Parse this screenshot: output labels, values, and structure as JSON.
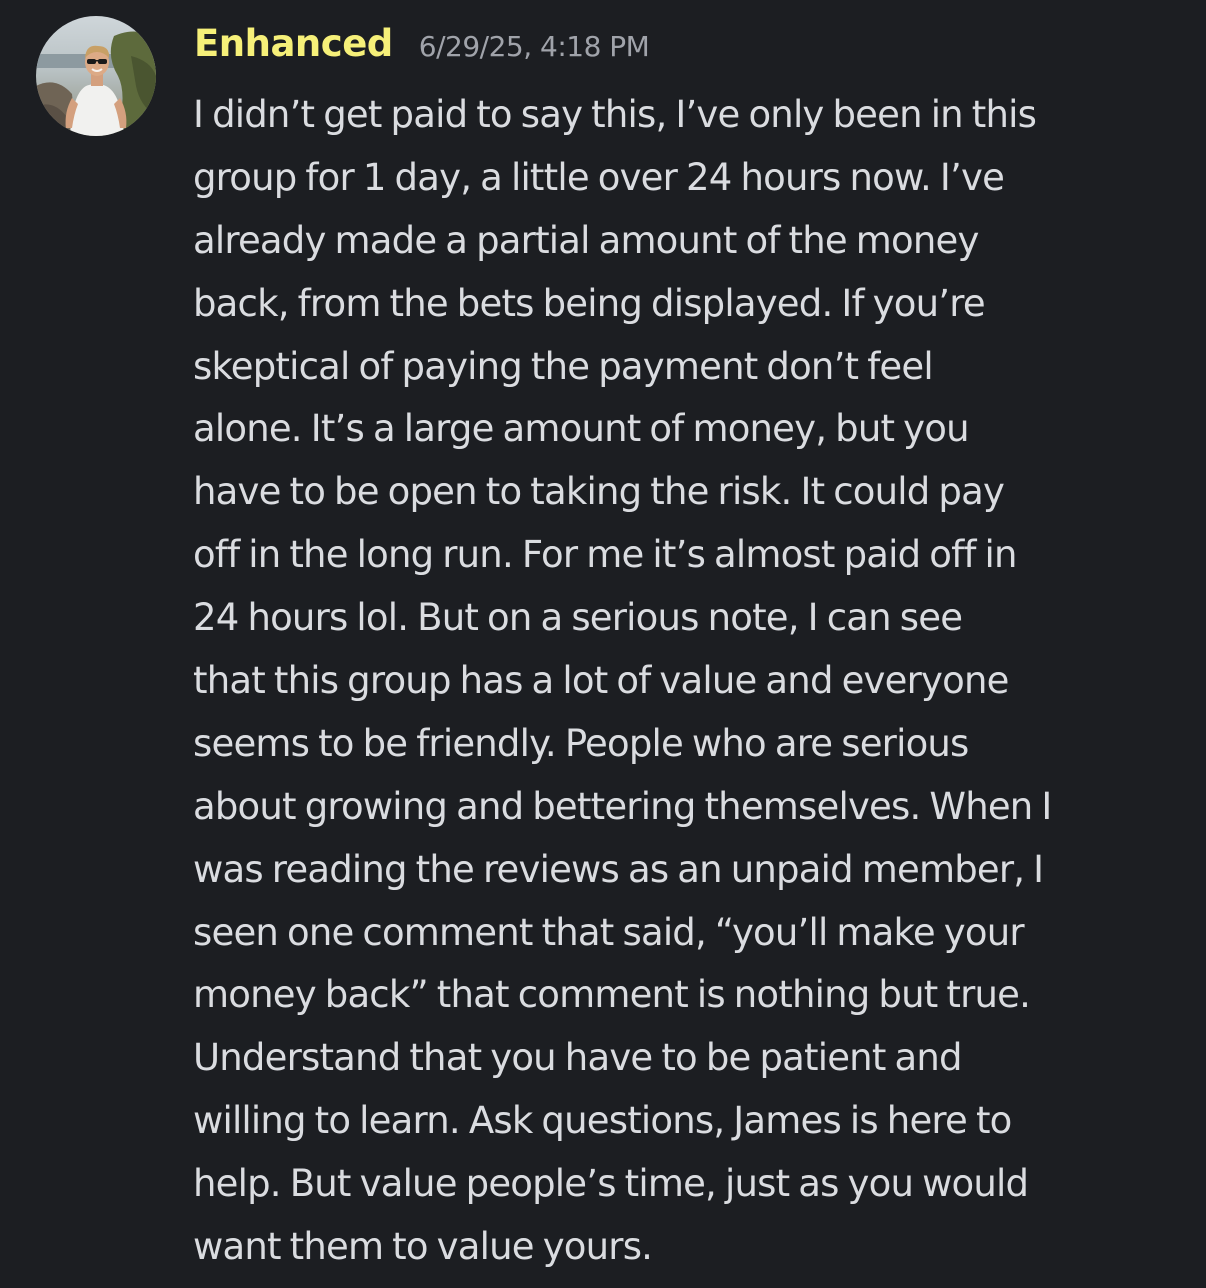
{
  "message": {
    "author": "Enhanced",
    "timestamp": "6/29/25, 4:18 PM",
    "avatar_icon": "user-avatar-photo",
    "author_color": "#f6f079",
    "lines": [
      "I didn’t get paid to say this, I’ve only been in this",
      "group for 1 day, a little over 24 hours now. I’ve",
      "already made a partial amount of the money",
      "back, from the bets being displayed. If you’re",
      "skeptical of paying the payment don’t feel",
      "alone. It’s a large amount of money, but you",
      "have to be open to taking the risk. It could pay",
      "off in the long run. For me it’s almost paid off in",
      "24 hours lol. But on a serious note, I can see",
      "that this group has a lot of value and everyone",
      "seems to be friendly. People who are serious",
      "about growing and bettering themselves. When I",
      "was reading the reviews as an unpaid member, I",
      "seen one comment that said, “you’ll make your",
      "money back” that comment is nothing but true.",
      "Understand that you have to be patient and",
      "willing to learn. Ask questions, James is here to",
      "help. But value people’s time, just as you would",
      "want them to value yours."
    ]
  }
}
